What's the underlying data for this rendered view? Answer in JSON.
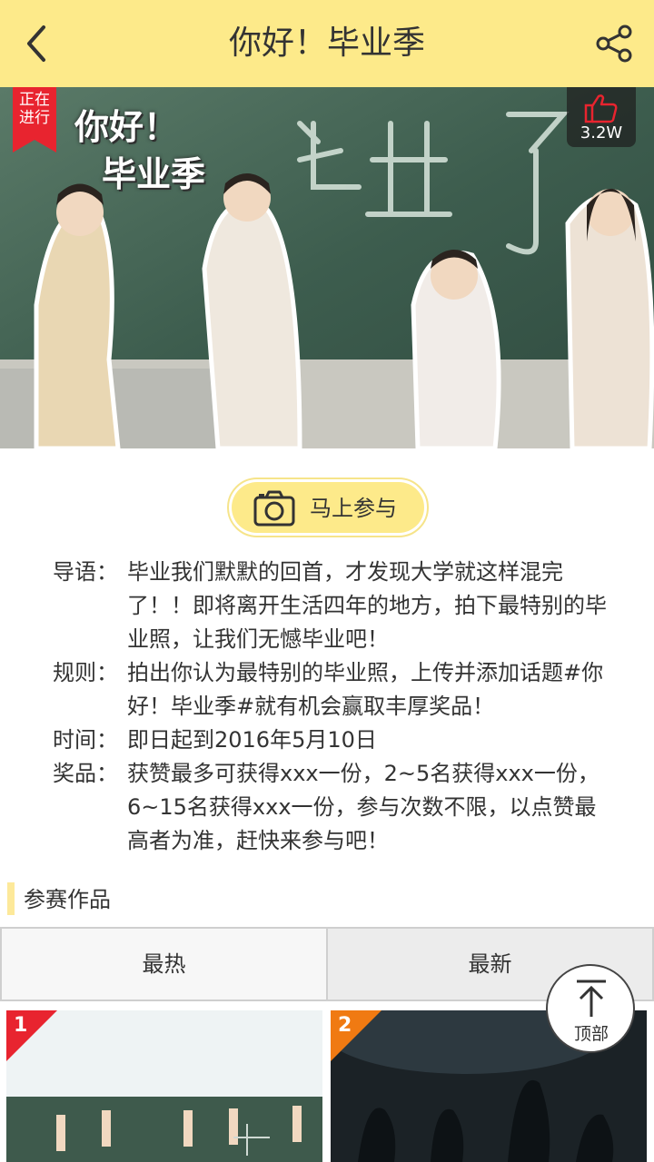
{
  "header": {
    "title": "你好！毕业季",
    "back_icon": "chevron-left-icon",
    "share_icon": "share-icon"
  },
  "banner": {
    "status_badge": "正在进行",
    "title_line1": "你好！",
    "title_line2": "毕业季",
    "board_text": "毕业了",
    "like_icon": "thumbs-up-icon",
    "like_count": "3.2W"
  },
  "join_button": {
    "label": "马上参与",
    "icon": "camera-icon"
  },
  "info": [
    {
      "key": "导语：",
      "value": "毕业我们默默的回首，才发现大学就这样混完了！！即将离开生活四年的地方，拍下最特别的毕业照，让我们无憾毕业吧！"
    },
    {
      "key": "规则：",
      "value": "拍出你认为最特别的毕业照，上传并添加话题#你好！毕业季#就有机会赢取丰厚奖品！"
    },
    {
      "key": "时间：",
      "value": "即日起到2016年5月10日"
    },
    {
      "key": "奖品：",
      "value": "获赞最多可获得xxx一份，2~5名获得xxx一份，6~15名获得xxx一份，参与次数不限，以点赞最高者为准，赶快来参与吧！"
    }
  ],
  "section": {
    "title": "参赛作品"
  },
  "tabs": {
    "hot": "最热",
    "new": "最新"
  },
  "top_button": {
    "label": "顶部",
    "icon": "arrow-up-icon"
  },
  "cards": [
    {
      "rank": "1",
      "badge_color": "#e8242f"
    },
    {
      "rank": "2",
      "badge_color": "#f07a12"
    }
  ],
  "colors": {
    "header_bg": "#fdea8a",
    "accent_yellow": "#fdea8a",
    "like_red": "#e8242f"
  }
}
